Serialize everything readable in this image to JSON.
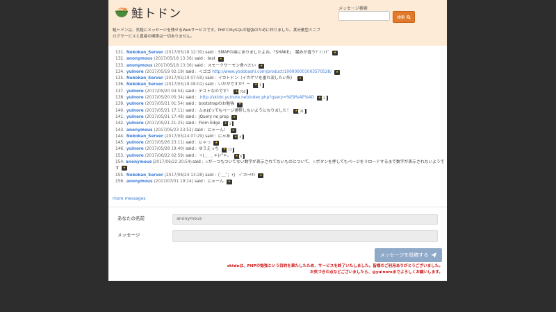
{
  "app": {
    "title": "鮭トドン",
    "description": "鮭トドンは、気軽にメッセージを残せるWebサービスです。PHPとMySQLの勉強のために作りました。某分散型ミニブログサービスと直接の関係は一切ありません。"
  },
  "search": {
    "label": "メッセージ検索",
    "placeholder": "",
    "button_label": "検索",
    "button_icon": "search-icon"
  },
  "messages": [
    {
      "num": "131.",
      "user": "Nekokan_Server",
      "date": "(2017/05/18 12:30)",
      "said": "said :",
      "text": "SMAPの曲にありましたよね、「SHAKE」　踊みが違う？ﾄﾆﾄﾄﾞ",
      "link": "",
      "count": ""
    },
    {
      "num": "132.",
      "user": "anonymous",
      "date": "(2017/05/18 13:36)",
      "said": "said :",
      "text": "test",
      "link": "",
      "count": ""
    },
    {
      "num": "133.",
      "user": "anonymous",
      "date": "(2017/05/18 13:36)",
      "said": "said :",
      "text": "スモークサーモン食べたい",
      "link": "",
      "count": ""
    },
    {
      "num": "134.",
      "user": "yuinore",
      "date": "(2017/05/19 02:19)",
      "said": "said :",
      "text": "＜ゴゴ",
      "link": "http://www.yodobashi.com/product/100000001003570528/",
      "count": ""
    },
    {
      "num": "135.",
      "user": "Nekokan_Server",
      "date": "(2017/05/19 07:59)",
      "said": "said :",
      "text": "イカトドン（イカゲソを垂れ流したい所）",
      "link": "",
      "count": ""
    },
    {
      "num": "136.",
      "user": "Nekokan_Server",
      "date": "(2017/05/19 08:01)",
      "said": "said :",
      "text": "いかがですか？ー",
      "link": "",
      "count": "1"
    },
    {
      "num": "137.",
      "user": "yuinore",
      "date": "(2017/05/20 04:54)",
      "said": "said :",
      "text": "テストなのです！",
      "link": "",
      "count": "735"
    },
    {
      "num": "138.",
      "user": "yuinore",
      "date": "(2017/05/20 05:34)",
      "said": "said :",
      "text": "",
      "link": "http://sktdn.yuinore.net/index.php?query=%E9%AE%AD",
      "count": "3"
    },
    {
      "num": "139.",
      "user": "yuinore",
      "date": "(2017/05/21 01:54)",
      "said": "said :",
      "text": "bootstrapのお勉強",
      "link": "",
      "count": ""
    },
    {
      "num": "140.",
      "user": "yuinore",
      "date": "(2017/05/21 17:11)",
      "said": "said :",
      "text": "ふぁぼってもページ遷移しないようになりました！",
      "link": "",
      "count": "31"
    },
    {
      "num": "141.",
      "user": "yuinore",
      "date": "(2017/05/21 17:48)",
      "said": "said :",
      "text": "jQuery no prop",
      "link": "",
      "count": ""
    },
    {
      "num": "142.",
      "user": "yuinore",
      "date": "(2017/05/21 21:25)",
      "said": "said :",
      "text": "From Edge",
      "link": "",
      "count": "1"
    },
    {
      "num": "143.",
      "user": "anonymous",
      "date": "(2017/05/23 23:52)",
      "said": "said :",
      "text": "にゃーん！",
      "link": "",
      "count": ""
    },
    {
      "num": "144.",
      "user": "Nekokan_Server",
      "date": "(2017/05/24 07:29)",
      "said": "said :",
      "text": "にゃあ",
      "link": "",
      "count": "4"
    },
    {
      "num": "145.",
      "user": "yuinore",
      "date": "(2017/05/26 23:11)",
      "said": "said :",
      "text": "にゃっ",
      "link": "",
      "count": ""
    },
    {
      "num": "146.",
      "user": "yuinore",
      "date": "(2017/05/28 19:40)",
      "said": "said :",
      "text": "ゆうえっち",
      "link": "",
      "count": "13"
    },
    {
      "num": "153.",
      "user": "yuinore",
      "date": "(2017/06/22 02:59)",
      "said": "said :",
      "text": "ヾ(＿ ＿＊)ﾉ\"＊。",
      "link": "",
      "count": "6"
    },
    {
      "num": "154.",
      "user": "anonymous",
      "date": "(2017/06/22 20:54)",
      "said": "said :",
      "text": "☆が一つもついてない数字が表示されてないものについて、☆ボタンを押してもページをリロードするまで数字が表示されないようです",
      "link": "",
      "count": "",
      "wrap": true
    },
    {
      "num": "155.",
      "user": "Nekokan_Server",
      "date": "(2017/06/24 13:28)",
      "said": "said :",
      "text": "(ﾟ＿ﾟ；ｲ)　ﾍﾟｺﾘｰﾅｵｼ",
      "link": "",
      "count": ""
    },
    {
      "num": "156.",
      "user": "anonymous",
      "date": "(2017/07/01 19:14)",
      "said": "said :",
      "text": "にゃーん",
      "link": "",
      "count": ""
    }
  ],
  "more_messages": "more messages",
  "form": {
    "name_label": "あなたの名前",
    "name_value": "anonymous",
    "message_label": "メッセージ",
    "message_value": "",
    "post_button": "メッセージを投稿する",
    "post_icon": "paper-plane-icon"
  },
  "notice": {
    "line1": "sktdnは、PHPの勉強という目的を果たしたため、サービスを終了いたしました。皆様のご利用ありがとうございました。",
    "line2": "お気づきの点などございましたら、@yuinoreまでよろしくお願いします。"
  },
  "colors": {
    "header_bg": "#fdebd8",
    "accent": "#e07a2a",
    "link": "#3a7bd5",
    "notice": "#d01414",
    "page_bg": "#2d2d2d",
    "post_button": "#8fa9c8"
  }
}
